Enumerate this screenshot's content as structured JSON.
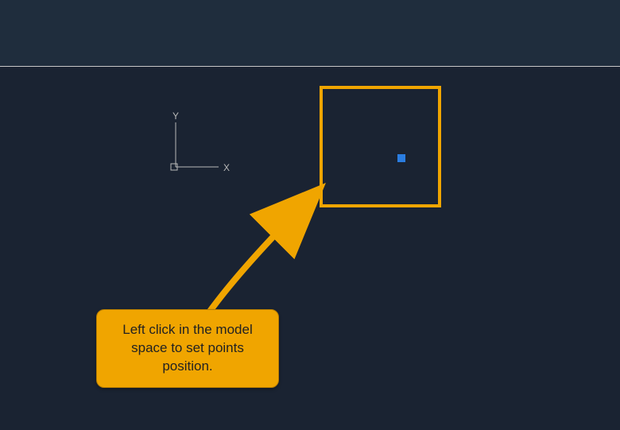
{
  "ucs": {
    "x_label": "X",
    "y_label": "Y"
  },
  "annotation": {
    "tooltip_text": "Left click in the model space to set points position.",
    "highlight_color": "#f0a500",
    "arrow_color": "#f0a500"
  },
  "point": {
    "color": "#2a7de1"
  }
}
